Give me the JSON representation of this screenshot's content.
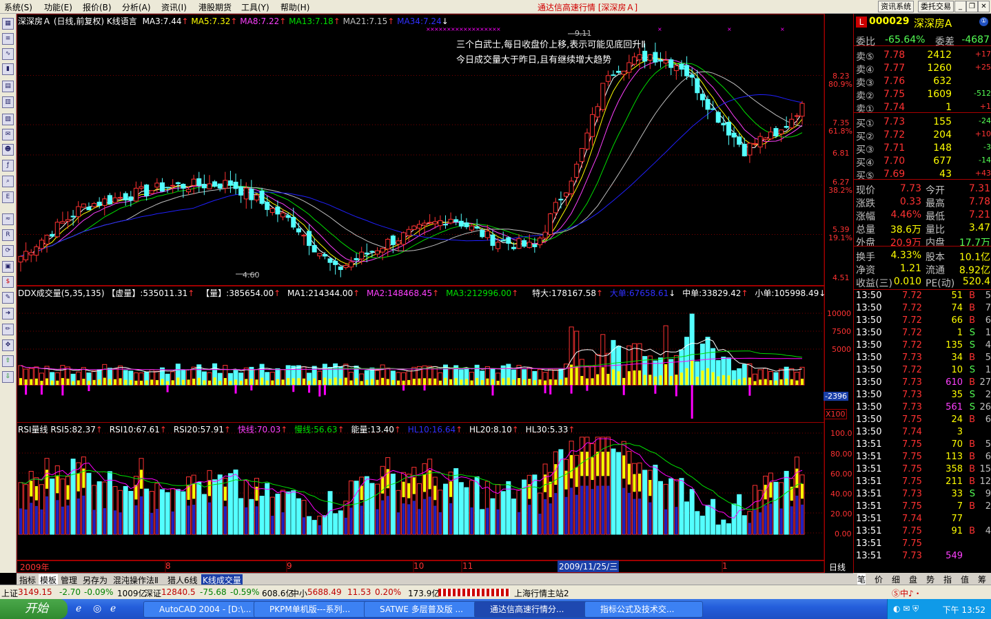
{
  "menu": [
    "系统(S)",
    "功能(E)",
    "报价(B)",
    "分析(A)",
    "资讯(I)",
    "港股期货",
    "工具(Y)",
    "帮助(H)"
  ],
  "app_title": "通达信高速行情 [深深房Ａ]",
  "top_buttons": [
    "资讯系统",
    "委托交易"
  ],
  "colors": {
    "up": "#ff3232",
    "down": "#54ffff",
    "ma3": "#ffffff",
    "ma5": "#ffff00",
    "ma8": "#ff40ff",
    "ma13": "#00e000",
    "ma21": "#c0c0c0",
    "ma34": "#2020ff",
    "bg": "#000000",
    "grid": "#800000",
    "yellow": "#ffff00",
    "magenta": "#ff00ff"
  },
  "main_header": {
    "name": "深深房Ａ",
    "period": "(日线,前复权)",
    "lang": "K线语言",
    "ma3": "MA3:7.44",
    "ma5": "MA5:7.32",
    "ma8": "MA8:7.22",
    "ma13": "MA13:7.18",
    "ma21": "MA21:7.15",
    "ma34": "MA34:7.24"
  },
  "annotations": {
    "line1": "三个白武士,每日收盘价上移,表示可能见底回升Ⅱ",
    "line2": "今日成交量大于昨日,且有继续增大趋势",
    "high_label": "9.11",
    "low_label": "4.60"
  },
  "price_axis": [
    {
      "v": "8.23"
    },
    {
      "v": "80.9%",
      "pct": true
    },
    {
      "v": "7.35"
    },
    {
      "v": "61.8%",
      "pct": true
    },
    {
      "v": "6.81"
    },
    {
      "v": "6.27"
    },
    {
      "v": "38.2%",
      "pct": true
    },
    {
      "v": "5.39"
    },
    {
      "v": "19.1%",
      "pct": true
    },
    {
      "v": "4.51"
    }
  ],
  "vol_header": {
    "name": "DDX成交量(5,35,135)",
    "xv": "【虚量】:535011.31",
    "v": "【量】:385654.00",
    "ma1": "MA1:214344.00",
    "ma2": "MA2:148468.45",
    "ma3": "MA3:212996.00",
    "tedа": "特大:178167.58",
    "da": "大单:67658.61",
    "zhong": "中单:33829.42",
    "xiao": "小单:105998.49"
  },
  "vol_axis": [
    "10000",
    "7500",
    "5000",
    "-2396",
    "X100"
  ],
  "rsi_header": {
    "name": "RSI量线",
    "rsi5": "RSI5:82.37",
    "rsi10": "RSI10:67.61",
    "rsi20": "RSI20:57.91",
    "fast": "快线:70.03",
    "slow": "慢线:56.63",
    "energy": "能量:13.40",
    "hl10": "HL10:16.64",
    "hl20": "HL20:8.10",
    "hl30": "HL30:5.33"
  },
  "rsi_axis": [
    "100.0",
    "80.00",
    "60.00",
    "40.00",
    "20.00",
    "0.00"
  ],
  "date_axis": [
    "2009年",
    "8",
    "9",
    "10",
    "11",
    "2009/11/25/三",
    "1",
    "日线"
  ],
  "tabs": [
    "指标",
    "模板",
    "管理",
    "另存为",
    "混沌操作法Ⅱ",
    "猎人6线",
    "K线成交量"
  ],
  "right_tabs": [
    "笔",
    "价",
    "细",
    "盘",
    "势",
    "指",
    "值",
    "筹"
  ],
  "quote": {
    "code": "000029",
    "name": "深深房A",
    "wb_label": "委比",
    "wb": "-65.64%",
    "wc_label": "委差",
    "wc": "-4687",
    "asks": [
      {
        "l": "卖⑤",
        "p": "7.78",
        "v": "2412",
        "c": "+17"
      },
      {
        "l": "卖④",
        "p": "7.77",
        "v": "1260",
        "c": "+25"
      },
      {
        "l": "卖③",
        "p": "7.76",
        "v": "632",
        "c": ""
      },
      {
        "l": "卖②",
        "p": "7.75",
        "v": "1609",
        "c": "-512"
      },
      {
        "l": "卖①",
        "p": "7.74",
        "v": "1",
        "c": "+1"
      }
    ],
    "bids": [
      {
        "l": "买①",
        "p": "7.73",
        "v": "155",
        "c": "-24"
      },
      {
        "l": "买②",
        "p": "7.72",
        "v": "204",
        "c": "+10"
      },
      {
        "l": "买③",
        "p": "7.71",
        "v": "148",
        "c": "-3"
      },
      {
        "l": "买④",
        "p": "7.70",
        "v": "677",
        "c": "-14"
      },
      {
        "l": "买⑤",
        "p": "7.69",
        "v": "43",
        "c": "+43"
      }
    ],
    "stats": [
      [
        "现价",
        "7.73",
        "今开",
        "7.31"
      ],
      [
        "涨跌",
        "0.33",
        "最高",
        "7.78"
      ],
      [
        "涨幅",
        "4.46%",
        "最低",
        "7.21"
      ],
      [
        "总量",
        "38.6万",
        "量比",
        "3.47"
      ],
      [
        "外盘",
        "20.9万",
        "内盘",
        "17.7万"
      ]
    ],
    "stats2": [
      [
        "换手",
        "4.33%",
        "股本",
        "10.1亿"
      ],
      [
        "净资",
        "1.21",
        "流通",
        "8.92亿"
      ],
      [
        "收益(三)",
        "0.010",
        "PE(动)",
        "520.4"
      ]
    ]
  },
  "ticks": [
    [
      "13:50",
      "7.72",
      "51",
      "B",
      "5"
    ],
    [
      "13:50",
      "7.72",
      "74",
      "B",
      "7"
    ],
    [
      "13:50",
      "7.72",
      "66",
      "B",
      "6"
    ],
    [
      "13:50",
      "7.72",
      "1",
      "S",
      "1"
    ],
    [
      "13:50",
      "7.72",
      "135",
      "S",
      "4"
    ],
    [
      "13:50",
      "7.73",
      "34",
      "B",
      "5"
    ],
    [
      "13:50",
      "7.72",
      "10",
      "S",
      "1"
    ],
    [
      "13:50",
      "7.73",
      "610",
      "B",
      "27"
    ],
    [
      "13:50",
      "7.73",
      "35",
      "S",
      "2"
    ],
    [
      "13:50",
      "7.73",
      "561",
      "S",
      "26"
    ],
    [
      "13:50",
      "7.75",
      "24",
      "B",
      "6"
    ],
    [
      "13:50",
      "7.74",
      "3",
      "",
      ""
    ],
    [
      "13:51",
      "7.75",
      "70",
      "B",
      "5"
    ],
    [
      "13:51",
      "7.75",
      "113",
      "B",
      "6"
    ],
    [
      "13:51",
      "7.75",
      "358",
      "B",
      "15"
    ],
    [
      "13:51",
      "7.75",
      "211",
      "B",
      "12"
    ],
    [
      "13:51",
      "7.73",
      "33",
      "S",
      "9"
    ],
    [
      "13:51",
      "7.75",
      "7",
      "B",
      "2"
    ],
    [
      "13:51",
      "7.74",
      "77",
      "",
      ""
    ],
    [
      "13:51",
      "7.75",
      "91",
      "B",
      "4"
    ],
    [
      "13:51",
      "7.75",
      "",
      "",
      ""
    ],
    [
      "13:51",
      "7.73",
      "549",
      "",
      ""
    ]
  ],
  "status": {
    "sh_label": "上证",
    "sh": "3149.15",
    "sh_chg": "-2.70",
    "sh_pct": "-0.09%",
    "sh_amt": "1009亿",
    "sz_label": "深证",
    "sz": "12840.5",
    "sz_chg": "-75.68",
    "sz_pct": "-0.59%",
    "sz_amt": "608.6亿",
    "zx_label": "中小",
    "zx": "5688.49",
    "zx_chg": "11.53",
    "zx_pct": "0.20%",
    "zx_amt": "173.9亿",
    "server": "上海行情主站2"
  },
  "taskbar": {
    "start": "开始",
    "tasks": [
      "AutoCAD 2004 - [D:\\...",
      "PKPM单机版---系列...",
      "SATWE 多层普及版 ...",
      "通达信高速行情分...",
      "指标公式及技术交..."
    ],
    "clock": "下午 13:52"
  },
  "chart_data": {
    "type": "candlestick",
    "title": "深深房Ａ (日线,前复权)",
    "x_labels": [
      "2009年",
      "8",
      "9",
      "10",
      "11",
      "2009/11/25/三",
      "1"
    ],
    "ylim": [
      4.51,
      9.11
    ],
    "high": 9.11,
    "low": 4.6,
    "key_closes": [
      {
        "label": "start",
        "v": 5.0
      },
      {
        "label": "peak",
        "v": 8.6
      },
      {
        "label": "trough",
        "v": 4.7
      },
      {
        "label": "last",
        "v": 7.73
      }
    ],
    "y_ticks": [
      8.23,
      7.35,
      6.81,
      6.27,
      5.39,
      4.51
    ],
    "fib_levels": [
      "80.9%",
      "61.8%",
      "38.2%",
      "19.1%"
    ],
    "series": [
      {
        "name": "MA3",
        "value": 7.44
      },
      {
        "name": "MA5",
        "value": 7.32
      },
      {
        "name": "MA8",
        "value": 7.22
      },
      {
        "name": "MA13",
        "value": 7.18
      },
      {
        "name": "MA21",
        "value": 7.15
      },
      {
        "name": "MA34",
        "value": 7.24
      }
    ],
    "volume_ylim": [
      0,
      10000
    ],
    "rsi_ylim": [
      0,
      100
    ]
  }
}
